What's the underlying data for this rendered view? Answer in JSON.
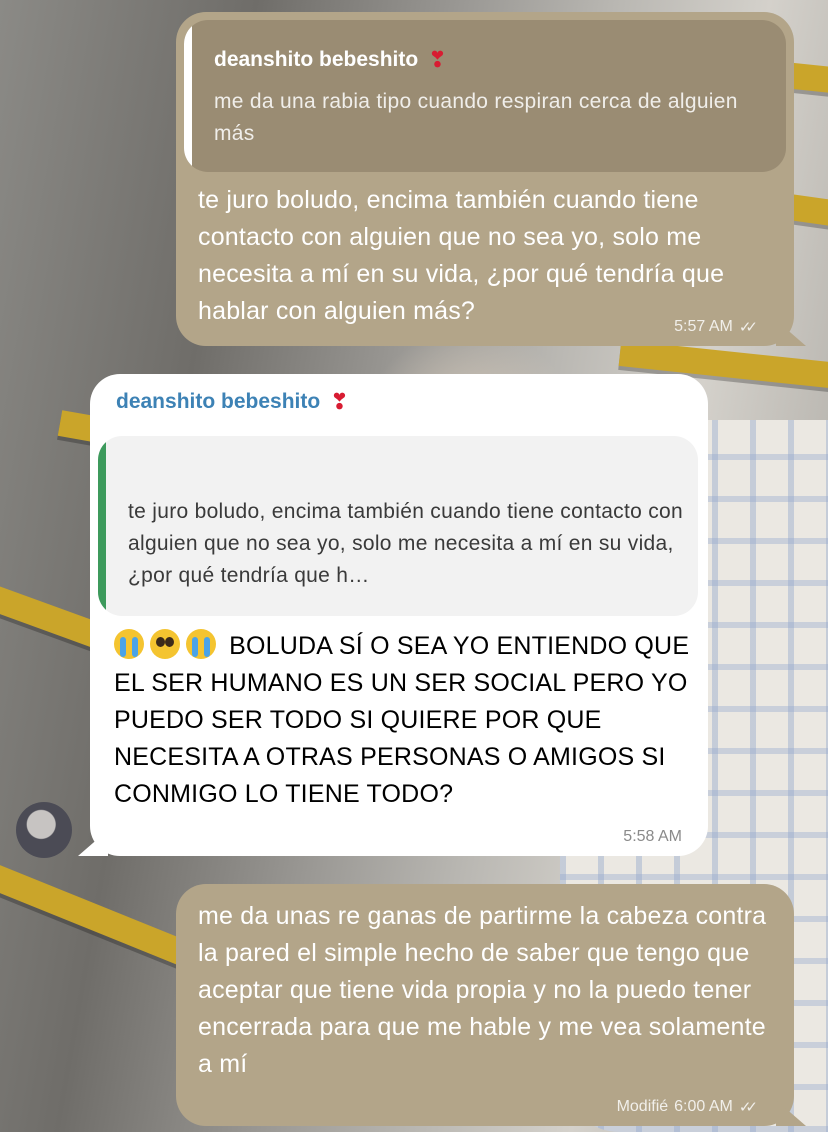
{
  "messages": {
    "m1": {
      "quote_name": "deanshito bebeshito",
      "quote_icon": "heart-exclamation-icon",
      "quote_text": "me da una rabia tipo cuando respiran cerca de alguien más",
      "text": "te juro boludo, encima también cuando tiene contacto con alguien que no sea yo, solo me necesita a mí en su vida, ¿por qué tendría que hablar con alguien más?",
      "time": "5:57 AM"
    },
    "m2": {
      "sender": "deanshito bebeshito",
      "quote_text": "te juro boludo, encima también cuando tiene contacto con alguien que no sea yo, solo me necesita a mí en su vida, ¿por qué tendría que h…",
      "text": "BOLUDA SÍ O SEA YO ENTIENDO QUE EL SER HUMANO ES UN SER SOCIAL PERO YO PUEDO SER TODO SI QUIERE POR QUE NECESITA A OTRAS PERSONAS O AMIGOS SI CONMIGO LO TIENE TODO?",
      "emojis": [
        "loudly-crying-face",
        "pleading-face",
        "loudly-crying-face"
      ],
      "time": "5:58 AM"
    },
    "m3": {
      "text": "me da unas re ganas de partirme la cabeza contra la pared el simple hecho de saber que tengo que aceptar que tiene vida propia y no la puedo tener encerrada para que me hable y me vea solamente a mí",
      "edited_label": "Modifié",
      "time": "6:00 AM"
    }
  },
  "colors": {
    "outgoing_bubble": "#b3a589",
    "incoming_bubble": "#ffffff",
    "sender_name": "#3d82b5",
    "quote_bar_incoming": "#3d9a5c"
  }
}
